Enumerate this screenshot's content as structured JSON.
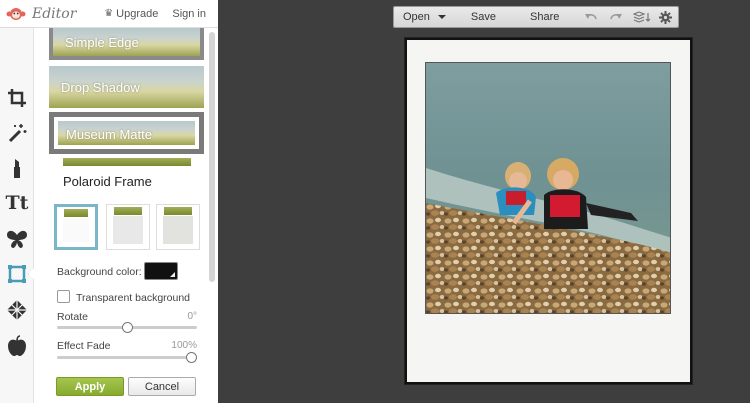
{
  "app": {
    "title": "Editor",
    "upgrade_label": "Upgrade",
    "signin_label": "Sign in"
  },
  "toolbar": {
    "tools": [
      "crop-icon",
      "magic-wand-icon",
      "lipstick-icon",
      "text-icon",
      "butterfly-icon",
      "frame-icon",
      "texture-icon",
      "apple-icon"
    ],
    "active": "frame-icon"
  },
  "frames": {
    "items": [
      {
        "label": "Simple Edge"
      },
      {
        "label": "Drop Shadow"
      },
      {
        "label": "Museum Matte"
      }
    ],
    "selected_title": "Polaroid Frame"
  },
  "options": {
    "background_color_label": "Background color:",
    "background_color": "#111111",
    "transparent_label": "Transparent background",
    "transparent_checked": false,
    "rotate_label": "Rotate",
    "rotate_value": "0°",
    "rotate_fraction": 0.5,
    "fade_label": "Effect Fade",
    "fade_value": "100%",
    "fade_fraction": 1.0,
    "apply_label": "Apply",
    "cancel_label": "Cancel"
  },
  "menu": {
    "open_label": "Open",
    "save_label": "Save",
    "share_label": "Share"
  },
  "colors": {
    "accent_green": "#8fb03a",
    "selection_blue": "#7ab6c8",
    "canvas_bg": "#3e3e3e"
  }
}
